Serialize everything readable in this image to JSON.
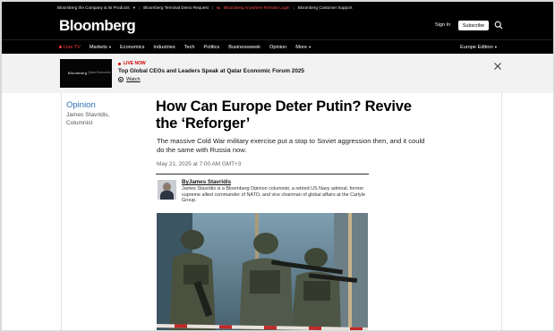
{
  "utility": {
    "company": "Bloomberg the Company & Its Products",
    "terminal": "Bloomberg Terminal Demo Request",
    "anywhere": "Bloomberg Anywhere Remote Login",
    "support": "Bloomberg Customer Support"
  },
  "header": {
    "logo": "Bloomberg",
    "sign_in": "Sign In",
    "subscribe": "Subscribe"
  },
  "nav": {
    "live_tv": "Live TV",
    "items": [
      "Markets",
      "Economics",
      "Industries",
      "Tech",
      "Politics",
      "Businessweek",
      "Opinion",
      "More"
    ],
    "edition": "Europe Edition"
  },
  "banner": {
    "live_now": "LIVE NOW",
    "title": "Top Global CEOs and Leaders Speak at Qatar Economic Forum 2025",
    "watch": "Watch",
    "thumb_logo": "Bloomberg",
    "thumb_sub": "Qatar Economic"
  },
  "article": {
    "section": "Opinion",
    "side_author": "James Stavridis,",
    "side_role": "Columnist",
    "headline": "How Can Europe Deter Putin? Revive the ‘Reforger’",
    "dek": "The massive Cold War military exercise put a stop to Soviet aggression then, and it could do the same with Russia now.",
    "date": "May 21, 2025 at 7:00 AM GMT+3",
    "byline": "ByJames Stavridis",
    "bio": "James Stavridis is a Bloomberg Opinion columnist, a retired US Navy admiral, former supreme allied commander of NATO, and vice chairman of global affairs at the Carlyle Group."
  },
  "colors": {
    "brand_black": "#000000",
    "live_red": "#ff3b3b",
    "opinion_blue": "#2a6fb5",
    "banner_bg": "#f2f2f2"
  }
}
